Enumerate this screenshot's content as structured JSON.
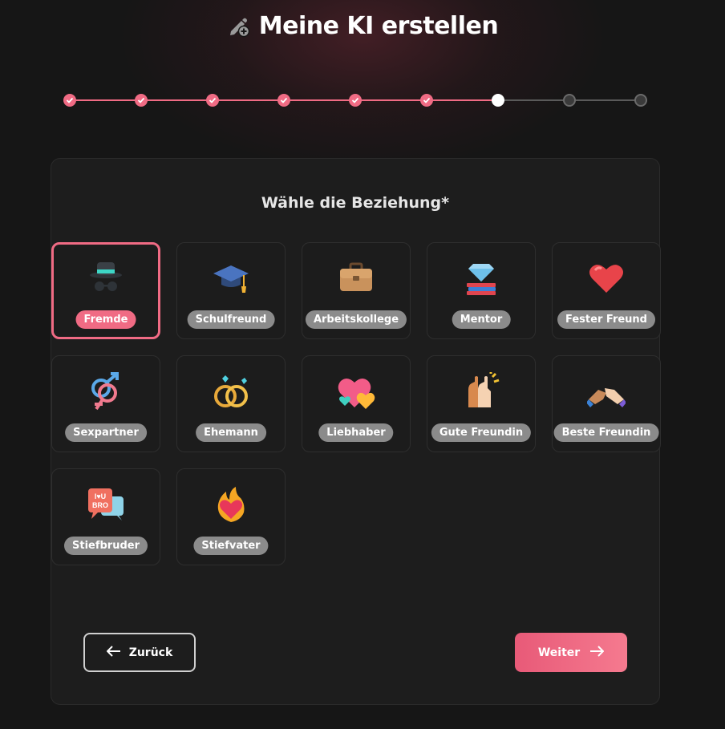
{
  "header": {
    "title": "Meine KI erstellen",
    "icon": "pencil-plus-icon"
  },
  "stepper": {
    "total_steps": 9,
    "completed_steps": 6,
    "current_step": 7
  },
  "section": {
    "title": "Wähle die Beziehung*"
  },
  "options": [
    {
      "label": "Fremde",
      "icon": "incognito-icon",
      "selected": true
    },
    {
      "label": "Schulfreund",
      "icon": "graduation-cap-icon",
      "selected": false
    },
    {
      "label": "Arbeitskollege",
      "icon": "briefcase-icon",
      "selected": false
    },
    {
      "label": "Mentor",
      "icon": "diamond-books-icon",
      "selected": false
    },
    {
      "label": "Fester Freund",
      "icon": "heart-icon",
      "selected": false
    },
    {
      "label": "Sexpartner",
      "icon": "gender-symbols-icon",
      "selected": false
    },
    {
      "label": "Ehemann",
      "icon": "rings-icon",
      "selected": false
    },
    {
      "label": "Liebhaber",
      "icon": "two-hearts-icon",
      "selected": false
    },
    {
      "label": "Gute Freundin",
      "icon": "high-five-icon",
      "selected": false
    },
    {
      "label": "Beste Freundin",
      "icon": "handshake-icon",
      "selected": false
    },
    {
      "label": "Stiefbruder",
      "icon": "bro-speech-bubble-icon",
      "selected": false
    },
    {
      "label": "Stiefvater",
      "icon": "fire-heart-icon",
      "selected": false
    }
  ],
  "buttons": {
    "back_label": "Zurück",
    "next_label": "Weiter"
  },
  "colors": {
    "accent": "#f06b84",
    "background": "#161616",
    "card": "#1d1d1d",
    "pill": "#8b8b8b"
  }
}
